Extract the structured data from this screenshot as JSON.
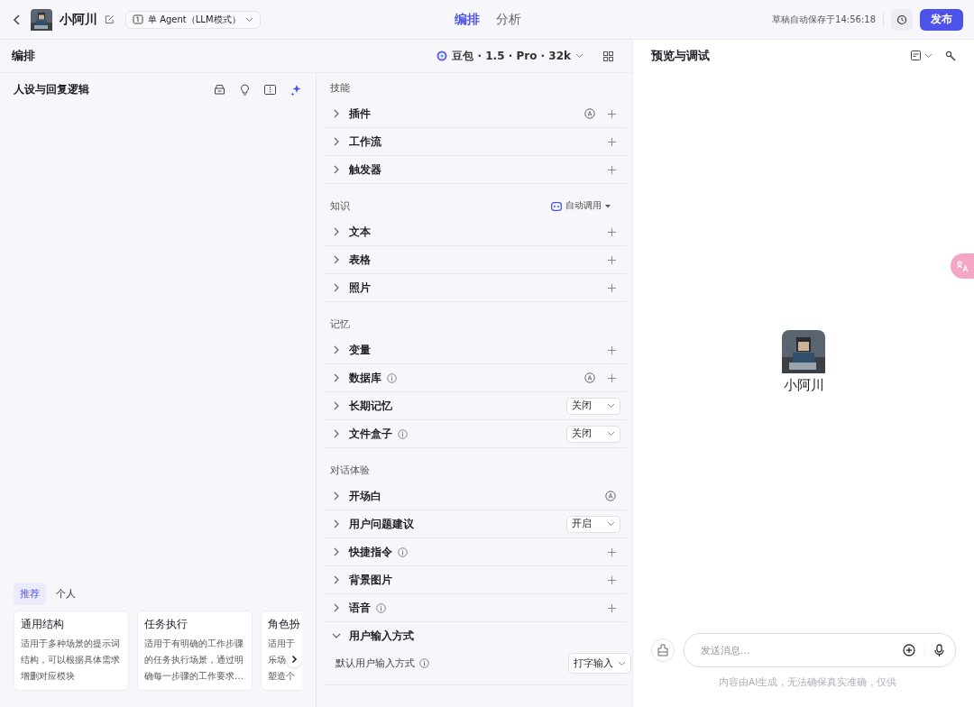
{
  "header": {
    "bot_name": "小阿川",
    "mode": "单 Agent（LLM模式）",
    "tabs": [
      {
        "label": "编排",
        "selected": true
      },
      {
        "label": "分析",
        "selected": false
      }
    ],
    "save_status": "草稿自动保存于14:56:18",
    "publish": "发布"
  },
  "editor": {
    "title": "编排",
    "model": "豆包 · 1.5 · Pro · 32k"
  },
  "persona": {
    "title": "人设与回复逻辑",
    "template_tabs": [
      {
        "label": "推荐",
        "selected": true
      },
      {
        "label": "个人",
        "selected": false
      }
    ],
    "templates": [
      {
        "title": "通用结构",
        "lines": [
          "适用于多种场景的提示词",
          "结构，可以根据具体需求",
          "增删对应模块"
        ]
      },
      {
        "title": "任务执行",
        "lines": [
          "适用于有明确的工作步骤",
          "的任务执行场景，通过明",
          "确每一步骤的工作要求…"
        ]
      },
      {
        "title": "角色扮",
        "lines": [
          "适用于",
          "乐场",
          "塑造个"
        ]
      }
    ]
  },
  "sections": [
    {
      "title": "技能",
      "items": [
        {
          "label": "插件",
          "kind": "add",
          "info": false,
          "auto": true,
          "expanded": false
        },
        {
          "label": "工作流",
          "kind": "add",
          "info": false,
          "auto": false,
          "expanded": false
        },
        {
          "label": "触发器",
          "kind": "add",
          "info": false,
          "auto": false,
          "expanded": false
        }
      ]
    },
    {
      "title": "知识",
      "control": "自动调用",
      "items": [
        {
          "label": "文本",
          "kind": "add",
          "info": false,
          "auto": false,
          "expanded": false
        },
        {
          "label": "表格",
          "kind": "add",
          "info": false,
          "auto": false,
          "expanded": false
        },
        {
          "label": "照片",
          "kind": "add",
          "info": false,
          "auto": false,
          "expanded": false
        }
      ]
    },
    {
      "title": "记忆",
      "items": [
        {
          "label": "变量",
          "kind": "add",
          "info": false,
          "auto": false,
          "expanded": false
        },
        {
          "label": "数据库",
          "kind": "add",
          "info": true,
          "auto": true,
          "expanded": false
        },
        {
          "label": "长期记忆",
          "kind": "select",
          "value": "关闭",
          "info": false,
          "auto": false,
          "expanded": false
        },
        {
          "label": "文件盒子",
          "kind": "select",
          "value": "关闭",
          "info": true,
          "auto": false,
          "expanded": false
        }
      ]
    },
    {
      "title": "对话体验",
      "items": [
        {
          "label": "开场白",
          "kind": "none",
          "info": false,
          "auto": true,
          "expanded": false
        },
        {
          "label": "用户问题建议",
          "kind": "select",
          "value": "开启",
          "info": false,
          "auto": false,
          "expanded": false
        },
        {
          "label": "快捷指令",
          "kind": "add",
          "info": true,
          "auto": false,
          "expanded": false
        },
        {
          "label": "背景图片",
          "kind": "add",
          "info": false,
          "auto": false,
          "expanded": false
        },
        {
          "label": "语音",
          "kind": "add",
          "info": true,
          "auto": false,
          "expanded": false
        },
        {
          "label": "用户输入方式",
          "kind": "none",
          "info": false,
          "auto": false,
          "expanded": true,
          "children": [
            {
              "label": "默认用户输入方式",
              "kind": "select",
              "value": "打字输入",
              "info": true
            }
          ]
        }
      ]
    }
  ],
  "preview": {
    "title": "预览与调试",
    "bot_name": "小阿川",
    "input_placeholder": "发送消息...",
    "disclaimer": "内容由AI生成，无法确保真实准确，仅供"
  }
}
